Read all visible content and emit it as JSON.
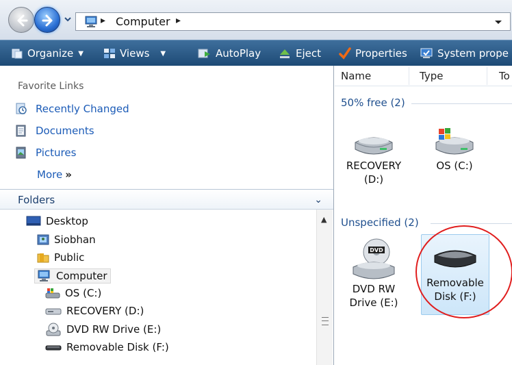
{
  "address_bar": {
    "back_button": "back-arrow",
    "forward_button": "forward-arrow",
    "breadcrumb": [
      "Computer"
    ]
  },
  "toolbar": {
    "organize": "Organize",
    "views": "Views",
    "autoplay": "AutoPlay",
    "eject": "Eject",
    "properties": "Properties",
    "system_properties": "System prope"
  },
  "favorite_links": {
    "title": "Favorite Links",
    "items": [
      {
        "label": "Recently Changed",
        "icon": "recent-icon"
      },
      {
        "label": "Documents",
        "icon": "documents-icon"
      },
      {
        "label": "Pictures",
        "icon": "pictures-icon"
      }
    ],
    "more": "More",
    "more_arrows": "»"
  },
  "folders": {
    "title": "Folders",
    "tree": [
      {
        "label": "Desktop",
        "icon": "desktop-icon"
      },
      {
        "label": "Siobhan",
        "icon": "user-folder-icon"
      },
      {
        "label": "Public",
        "icon": "folder-icon"
      },
      {
        "label": "Computer",
        "icon": "computer-icon",
        "selected": true
      },
      {
        "label": "OS (C:)",
        "icon": "windows-drive-icon"
      },
      {
        "label": "RECOVERY (D:)",
        "icon": "drive-icon"
      },
      {
        "label": "DVD RW Drive (E:)",
        "icon": "dvd-drive-icon"
      },
      {
        "label": "Removable Disk (F:)",
        "icon": "removable-disk-icon"
      }
    ]
  },
  "content": {
    "columns": [
      "Name",
      "Type",
      "To"
    ],
    "groups": [
      {
        "title": "50% free (2)",
        "items": [
          {
            "label_line1": "RECOVERY",
            "label_line2": "(D:)",
            "icon": "hard-drive-icon"
          },
          {
            "label_line1": "OS (C:)",
            "label_line2": "",
            "icon": "windows-drive-icon"
          }
        ]
      },
      {
        "title": "Unspecified (2)",
        "items": [
          {
            "label_line1": "DVD RW",
            "label_line2": "Drive (E:)",
            "icon": "dvd-drive-icon"
          },
          {
            "label_line1": "Removable",
            "label_line2": "Disk (F:)",
            "icon": "removable-disk-icon",
            "selected": true
          }
        ]
      }
    ]
  },
  "colors": {
    "toolbar": "#2a5885",
    "link": "#1b5bb7",
    "group_header": "#1f4f8e",
    "selection": "#cde6f9",
    "annotation": "#e01e1e"
  }
}
